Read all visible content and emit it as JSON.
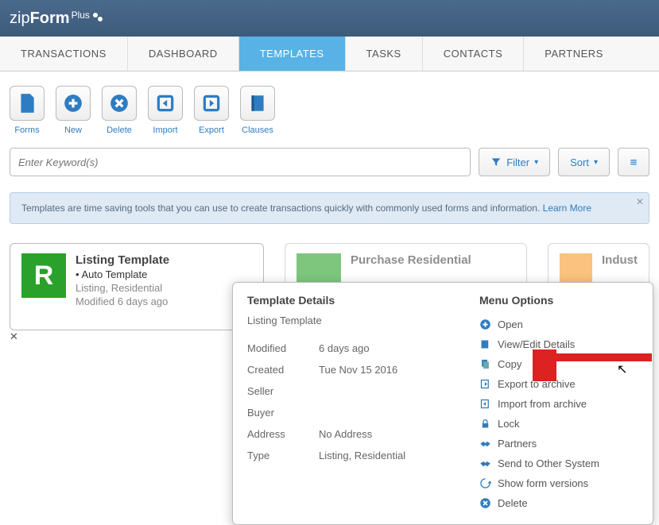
{
  "logo": {
    "zip": "zip",
    "form": "Form",
    "plus": "Plus"
  },
  "nav": {
    "items": [
      "TRANSACTIONS",
      "DASHBOARD",
      "TEMPLATES",
      "TASKS",
      "CONTACTS",
      "PARTNERS"
    ],
    "active": 2
  },
  "toolbar": {
    "items": [
      "Forms",
      "New",
      "Delete",
      "Import",
      "Export",
      "Clauses"
    ]
  },
  "search": {
    "placeholder": "Enter Keyword(s)"
  },
  "filter": {
    "label": "Filter"
  },
  "sort": {
    "label": "Sort"
  },
  "banner": {
    "text": "Templates are time saving tools that you can use to create transactions quickly with commonly used forms and information.",
    "link": "Learn More"
  },
  "cards": {
    "template1": {
      "letter": "R",
      "bg": "#2aa12a",
      "title": "Listing Template",
      "sub1": "Auto Template",
      "line1": "Listing, Residential",
      "line2": "Modified 6 days ago"
    },
    "template2": {
      "letter": "",
      "bg": "#2aa12a",
      "title": "Purchase Residential"
    },
    "template3": {
      "letter": "",
      "bg": "#f79a2a",
      "title": "Indust"
    }
  },
  "popup": {
    "detailsHeader": "Template Details",
    "menuHeader": "Menu Options",
    "name": "Listing Template",
    "rows": {
      "modifiedLabel": "Modified",
      "modified": "6 days ago",
      "createdLabel": "Created",
      "created": "Tue Nov 15 2016",
      "sellerLabel": "Seller",
      "seller": "",
      "buyerLabel": "Buyer",
      "buyer": "",
      "addressLabel": "Address",
      "address": "No Address",
      "typeLabel": "Type",
      "type": "Listing, Residential"
    },
    "menu": {
      "open": "Open",
      "viewEdit": "View/Edit Details",
      "copy": "Copy",
      "exportArchive": "Export to archive",
      "importArchive": "Import from archive",
      "lock": "Lock",
      "partners": "Partners",
      "sendOther": "Send to Other System",
      "showVersions": "Show form versions",
      "delete": "Delete"
    }
  }
}
